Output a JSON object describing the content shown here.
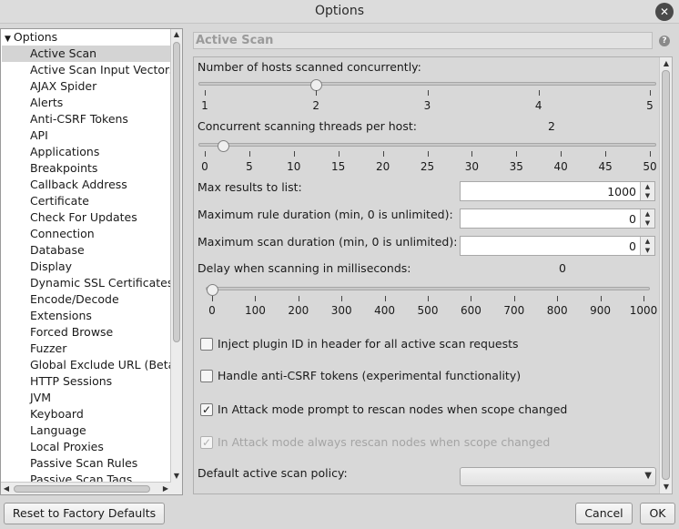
{
  "window": {
    "title": "Options"
  },
  "tree": {
    "root_label": "Options",
    "items": [
      "Active Scan",
      "Active Scan Input Vectors",
      "AJAX Spider",
      "Alerts",
      "Anti-CSRF Tokens",
      "API",
      "Applications",
      "Breakpoints",
      "Callback Address",
      "Certificate",
      "Check For Updates",
      "Connection",
      "Database",
      "Display",
      "Dynamic SSL Certificates",
      "Encode/Decode",
      "Extensions",
      "Forced Browse",
      "Fuzzer",
      "Global Exclude URL (Beta",
      "HTTP Sessions",
      "JVM",
      "Keyboard",
      "Language",
      "Local Proxies",
      "Passive Scan Rules",
      "Passive Scan Tags"
    ],
    "selected_index": 0
  },
  "panel": {
    "title": "Active Scan",
    "hosts": {
      "label": "Number of hosts scanned concurrently:",
      "value": 2,
      "ticks": [
        "1",
        "2",
        "3",
        "4",
        "5"
      ]
    },
    "threads": {
      "label": "Concurrent scanning threads per host:",
      "value": 2,
      "value_text": "2",
      "ticks": [
        "0",
        "5",
        "10",
        "15",
        "20",
        "25",
        "30",
        "35",
        "40",
        "45",
        "50"
      ]
    },
    "max_results": {
      "label": "Max results to list:",
      "value": "1000"
    },
    "max_rule": {
      "label": "Maximum rule duration (min, 0 is unlimited):",
      "value": "0"
    },
    "max_scan": {
      "label": "Maximum scan duration (min, 0 is unlimited):",
      "value": "0"
    },
    "delay": {
      "label": "Delay when scanning in milliseconds:",
      "value": 0,
      "value_text": "0",
      "ticks": [
        "0",
        "100",
        "200",
        "300",
        "400",
        "500",
        "600",
        "700",
        "800",
        "900",
        "1000"
      ]
    },
    "checkboxes": [
      {
        "label": "Inject plugin ID in header for all active scan requests",
        "checked": false,
        "enabled": true
      },
      {
        "label": "Handle anti-CSRF tokens (experimental functionality)",
        "checked": false,
        "enabled": true
      },
      {
        "label": "In Attack mode prompt to rescan nodes when scope changed",
        "checked": true,
        "enabled": true
      },
      {
        "label": "In Attack mode always rescan nodes when scope changed",
        "checked": true,
        "enabled": false
      }
    ],
    "policy": {
      "label": "Default active scan policy:",
      "value": ""
    }
  },
  "buttons": {
    "reset": "Reset to Factory Defaults",
    "cancel": "Cancel",
    "ok": "OK"
  },
  "glyphs": {
    "close": "✕",
    "check": "✓",
    "up": "▲",
    "down": "▼",
    "left": "◀",
    "right": "▶",
    "help": "?",
    "expand": "▼"
  }
}
